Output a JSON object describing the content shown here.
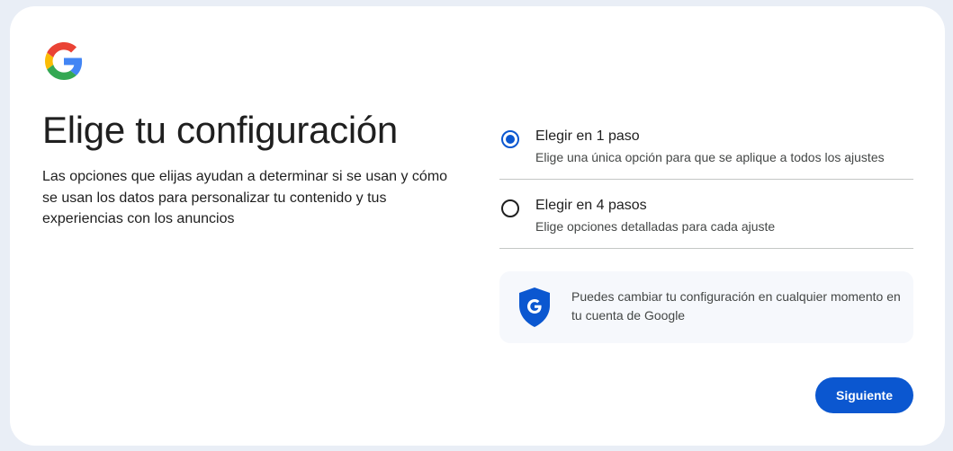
{
  "header": {
    "logo_icon": "google-g-icon",
    "title": "Elige tu configuración",
    "description": "Las opciones que elijas ayudan a determinar si se usan y cómo se usan los datos para personalizar tu contenido y tus experiencias con los anuncios"
  },
  "options": [
    {
      "title": "Elegir en 1 paso",
      "subtitle": "Elige una única opción para que se aplique a todos los ajustes",
      "selected": true
    },
    {
      "title": "Elegir en 4 pasos",
      "subtitle": "Elige opciones detalladas para cada ajuste",
      "selected": false
    }
  ],
  "info": {
    "icon": "google-shield-icon",
    "text": "Puedes cambiar tu configuración en cualquier momento en tu cuenta de Google"
  },
  "footer": {
    "next_label": "Siguiente"
  },
  "colors": {
    "accent": "#0b57d0",
    "background": "#e9eef6",
    "card": "#ffffff",
    "info_bg": "#f6f8fc"
  }
}
